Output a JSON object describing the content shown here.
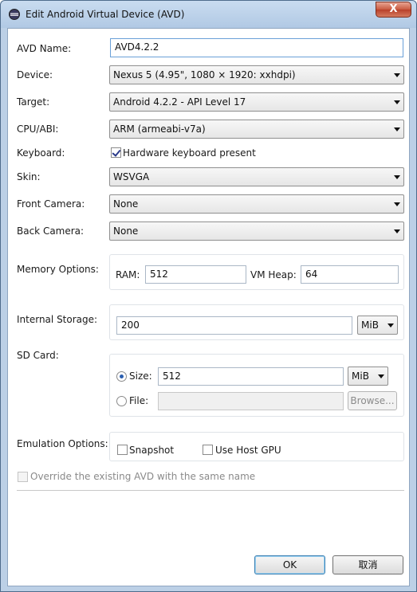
{
  "window": {
    "title": "Edit Android Virtual Device (AVD)",
    "close_glyph": "X"
  },
  "form": {
    "avd_name": {
      "label": "AVD Name:",
      "value": "AVD4.2.2"
    },
    "device": {
      "label": "Device:",
      "value": "Nexus 5 (4.95\", 1080 × 1920: xxhdpi)"
    },
    "target": {
      "label": "Target:",
      "value": "Android 4.2.2 - API Level 17"
    },
    "cpu": {
      "label": "CPU/ABI:",
      "value": "ARM (armeabi-v7a)"
    },
    "keyboard": {
      "label": "Keyboard:",
      "checkbox_label": "Hardware keyboard present",
      "checked": true
    },
    "skin": {
      "label": "Skin:",
      "value": "WSVGA"
    },
    "front_camera": {
      "label": "Front Camera:",
      "value": "None"
    },
    "back_camera": {
      "label": "Back Camera:",
      "value": "None"
    },
    "memory": {
      "label": "Memory Options:",
      "ram_label": "RAM:",
      "ram_value": "512",
      "vm_heap_label": "VM Heap:",
      "vm_heap_value": "64"
    },
    "internal_storage": {
      "label": "Internal Storage:",
      "value": "200",
      "unit": "MiB"
    },
    "sd_card": {
      "label": "SD Card:",
      "size_label": "Size:",
      "size_value": "512",
      "size_unit": "MiB",
      "size_selected": true,
      "file_label": "File:",
      "file_value": "",
      "browse_label": "Browse..."
    },
    "emulation": {
      "label": "Emulation Options:",
      "snapshot_label": "Snapshot",
      "snapshot_checked": false,
      "host_gpu_label": "Use Host GPU",
      "host_gpu_checked": false
    },
    "override_label": "Override the existing AVD with the same name"
  },
  "buttons": {
    "ok": "OK",
    "cancel": "取消"
  },
  "colors": {
    "accent": "#3c7fb1",
    "titlebar": "#bcd0e6",
    "close": "#c95a40"
  },
  "icons": {
    "title": "android-eclipse-icon",
    "close": "close-icon",
    "dropdown": "chevron-down-icon"
  }
}
